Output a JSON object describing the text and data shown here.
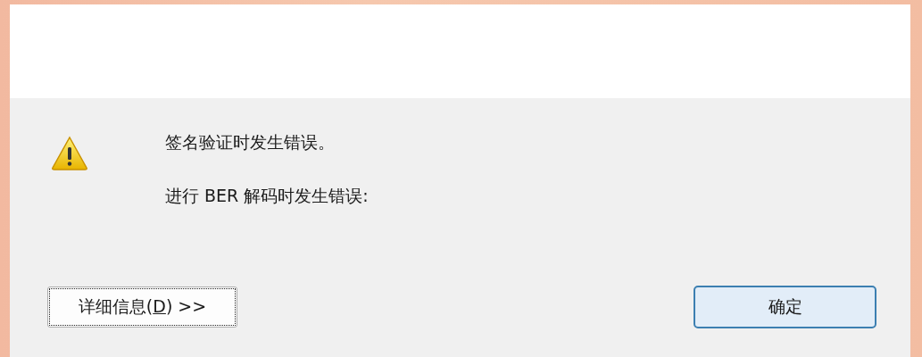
{
  "dialog": {
    "messages": [
      "签名验证时发生错误。",
      "进行 BER 解码时发生错误:"
    ],
    "buttons": [
      {
        "label_before": "详细信息(",
        "access_key": "D",
        "label_after": ") >>",
        "focused": true,
        "default": false
      },
      {
        "label_before": "确定",
        "focused": false,
        "default": true
      }
    ]
  }
}
